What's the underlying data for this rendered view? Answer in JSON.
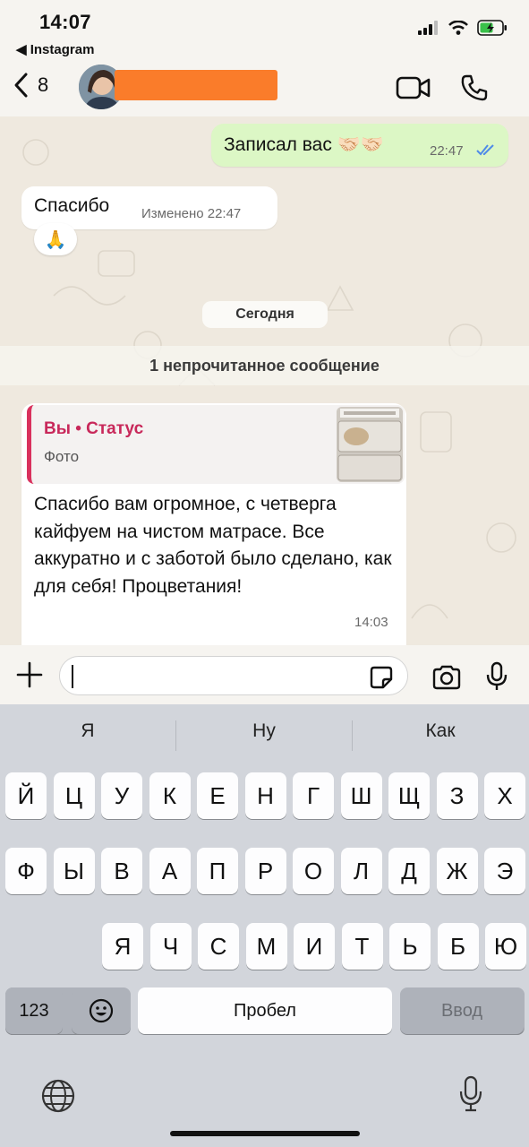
{
  "status_bar": {
    "time": "14:07",
    "back_app": "Instagram"
  },
  "header": {
    "unread_count": "8",
    "contact_name": "",
    "icons": [
      "chevron-left-icon",
      "video-call-icon",
      "phone-icon"
    ]
  },
  "messages": {
    "outgoing": {
      "text": "Записал вас 🤝🏻🤝🏻",
      "time": "22:47",
      "status": "read"
    },
    "incoming1": {
      "text": "Спасибо",
      "edited_label": "Изменено 22:47",
      "reaction": "🙏"
    },
    "date_separator": "Сегодня",
    "unread_banner": "1 непрочитанное сообщение",
    "incoming2": {
      "quote_author": "Вы • Статус",
      "quote_type": "Фото",
      "text": "Спасибо вам огромное, с четверга кайфуем на чистом матрасе. Все аккуратно и с заботой было сделано, как для себя! Процветания!",
      "time": "14:03"
    }
  },
  "input": {
    "value": "",
    "placeholder": ""
  },
  "keyboard": {
    "suggestions": [
      "Я",
      "Ну",
      "Как"
    ],
    "row1": [
      "Й",
      "Ц",
      "У",
      "К",
      "Е",
      "Н",
      "Г",
      "Ш",
      "Щ",
      "З",
      "Х"
    ],
    "row2": [
      "Ф",
      "Ы",
      "В",
      "А",
      "П",
      "Р",
      "О",
      "Л",
      "Д",
      "Ж",
      "Э"
    ],
    "row3": [
      "Я",
      "Ч",
      "С",
      "М",
      "И",
      "Т",
      "Ь",
      "Б",
      "Ю"
    ],
    "numbers_key": "123",
    "space_key": "Пробел",
    "return_key": "Ввод"
  },
  "colors": {
    "outgoing_bubble": "#dcf7c5",
    "quote_accent": "#d9315d",
    "ticks": "#4f8be8",
    "redaction": "#fa7c2a"
  }
}
